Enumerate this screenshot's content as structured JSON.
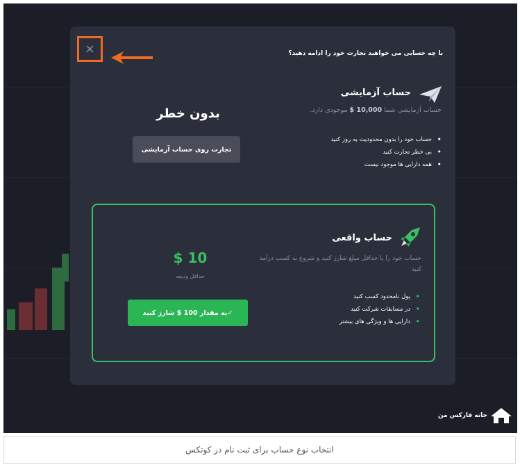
{
  "colors": {
    "accent_green": "#3ac062",
    "highlight_orange": "#f26a21",
    "modal_bg": "#2b2e3b",
    "page_bg": "#1b1e27"
  },
  "modal": {
    "close_icon": "×",
    "question": "با چه حسابی می خواهید تجارت خود را ادامه دهید؟",
    "demo": {
      "icon": "paper-plane-icon",
      "title": "حساب آزمایشی",
      "subtitle_pre": "حساب آزمایشی شما",
      "balance": "10,000 $",
      "subtitle_post": "موجودی دارد.",
      "features": [
        "حساب خود را بدون محدودیت به روز کنید",
        "بی خطر تجارت کنید",
        "همه دارایی ها موجود نیست"
      ],
      "risk_label": "بدون خطر",
      "button_label": "تجارت روی حساب آزمایشی"
    },
    "real": {
      "icon": "rocket-icon",
      "title": "حساب واقعی",
      "subtitle": "حساب خود را با حداقل مبلغ شارژ کنید و شروع به کسب درآمد کنید",
      "features": [
        "پول نامحدود کسب کنید",
        "در مسابقات شرکت کنید",
        "دارایی ها و ویژگی های بیشتر"
      ],
      "amount": "$ 10",
      "min_label": "حداقل ودیعه",
      "button_label": "✓به مقدار 100 $ شارژ کنید"
    }
  },
  "brand": {
    "name": "خانه فارکس من"
  },
  "caption": "انتخاب نوع حساب برای ثبت نام در کوتکس"
}
